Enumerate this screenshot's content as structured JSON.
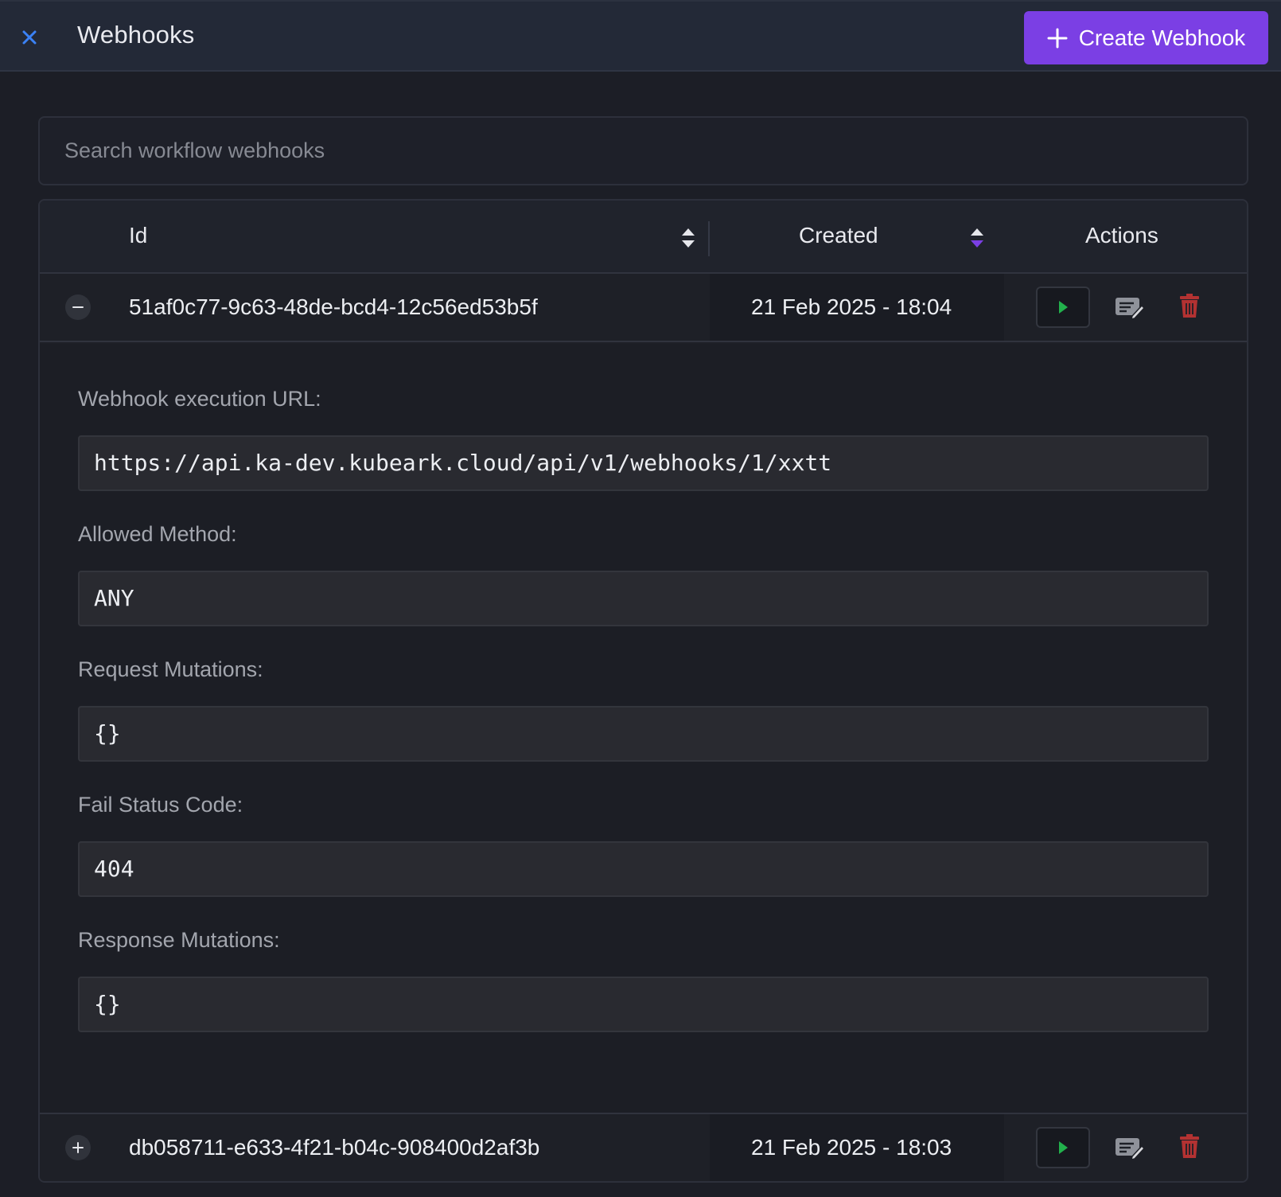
{
  "header": {
    "title": "Webhooks",
    "close_icon": "close-icon",
    "create_button_label": "Create Webhook",
    "create_button_icon": "plus-icon"
  },
  "search": {
    "placeholder": "Search workflow webhooks",
    "value": ""
  },
  "table": {
    "columns": [
      {
        "label": "Id",
        "sortable": true
      },
      {
        "label": "Created",
        "sortable": true,
        "active_sort": true
      },
      {
        "label": "Actions",
        "sortable": false
      }
    ],
    "rows": [
      {
        "id": "51af0c77-9c63-48de-bcd4-12c56ed53b5f",
        "created": "21 Feb 2025 - 18:04",
        "expanded": true,
        "details": {
          "url_label": "Webhook execution URL:",
          "url": "https://api.ka-dev.kubeark.cloud/api/v1/webhooks/1/xxtt",
          "method_label": "Allowed Method:",
          "method": "ANY",
          "request_mutations_label": "Request Mutations:",
          "request_mutations": "{}",
          "fail_status_label": "Fail Status Code:",
          "fail_status": "404",
          "response_mutations_label": "Response Mutations:",
          "response_mutations": "{}"
        }
      },
      {
        "id": "db058711-e633-4f21-b04c-908400d2af3b",
        "created": "21 Feb 2025 - 18:03",
        "expanded": false
      }
    ]
  },
  "colors": {
    "accent": "#7b3fe4",
    "sort_active": "#7b3fe4",
    "run": "#22b14c",
    "delete": "#b33232",
    "close": "#3b82f6"
  }
}
